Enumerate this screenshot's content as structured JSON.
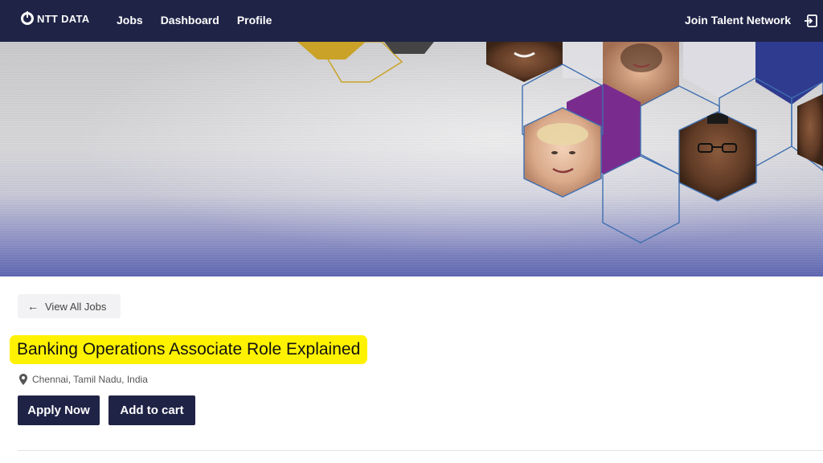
{
  "nav": {
    "logo_text": "NTT DATA",
    "links": [
      "Jobs",
      "Dashboard",
      "Profile"
    ],
    "talent_network": "Join Talent Network",
    "exit_icon": "sign-in-icon"
  },
  "banner": {
    "image": "hexagon collage of people's faces",
    "colors": {
      "purple": "#7a2b8e",
      "navy": "#2f3b8f",
      "gold": "#c9a227",
      "outline": "#3f6fb0"
    }
  },
  "job": {
    "back_label": "View All Jobs",
    "title": "Banking Operations Associate Role Explained",
    "location": "Chennai, Tamil Nadu, India",
    "apply_label": "Apply Now",
    "cart_label": "Add to cart"
  },
  "colors": {
    "nav_bg": "#1f2346",
    "highlight": "#fff200",
    "button_bg": "#1f2346"
  }
}
